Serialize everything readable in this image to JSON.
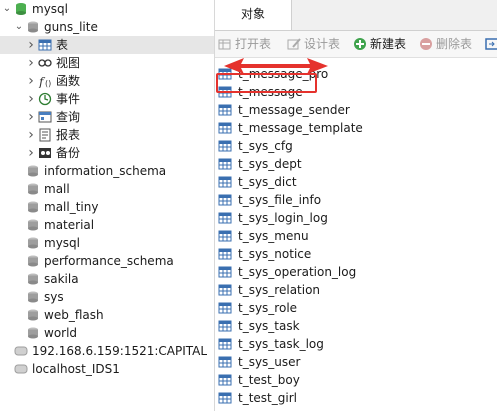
{
  "tree": {
    "items": [
      {
        "label": "mysql",
        "kind": "conn",
        "level": 0,
        "expand": "open",
        "selected": false
      },
      {
        "label": "guns_lite",
        "kind": "db",
        "level": 1,
        "expand": "open",
        "selected": false
      },
      {
        "label": "表",
        "kind": "table",
        "level": 2,
        "expand": "closed",
        "selected": true
      },
      {
        "label": "视图",
        "kind": "view",
        "level": 2,
        "expand": "closed",
        "selected": false
      },
      {
        "label": "函数",
        "kind": "func",
        "level": 2,
        "expand": "closed",
        "selected": false
      },
      {
        "label": "事件",
        "kind": "event",
        "level": 2,
        "expand": "closed",
        "selected": false
      },
      {
        "label": "查询",
        "kind": "query",
        "level": 2,
        "expand": "closed",
        "selected": false
      },
      {
        "label": "报表",
        "kind": "report",
        "level": 2,
        "expand": "closed",
        "selected": false
      },
      {
        "label": "备份",
        "kind": "backup",
        "level": 2,
        "expand": "closed",
        "selected": false
      },
      {
        "label": "information_schema",
        "kind": "db",
        "level": 1,
        "expand": "none",
        "selected": false
      },
      {
        "label": "mall",
        "kind": "db",
        "level": 1,
        "expand": "none",
        "selected": false
      },
      {
        "label": "mall_tiny",
        "kind": "db",
        "level": 1,
        "expand": "none",
        "selected": false
      },
      {
        "label": "material",
        "kind": "db",
        "level": 1,
        "expand": "none",
        "selected": false
      },
      {
        "label": "mysql",
        "kind": "db",
        "level": 1,
        "expand": "none",
        "selected": false
      },
      {
        "label": "performance_schema",
        "kind": "db",
        "level": 1,
        "expand": "none",
        "selected": false
      },
      {
        "label": "sakila",
        "kind": "db",
        "level": 1,
        "expand": "none",
        "selected": false
      },
      {
        "label": "sys",
        "kind": "db",
        "level": 1,
        "expand": "none",
        "selected": false
      },
      {
        "label": "web_flash",
        "kind": "db",
        "level": 1,
        "expand": "none",
        "selected": false
      },
      {
        "label": "world",
        "kind": "db",
        "level": 1,
        "expand": "none",
        "selected": false
      },
      {
        "label": "192.168.6.159:1521:CAPITAL",
        "kind": "server",
        "level": 0,
        "expand": "none",
        "selected": false
      },
      {
        "label": "localhost_IDS1",
        "kind": "server",
        "level": 0,
        "expand": "none",
        "selected": false
      }
    ]
  },
  "tabs": {
    "objects": "对象"
  },
  "toolbar": {
    "open": "打开表",
    "design": "设计表",
    "new": "新建表",
    "delete": "删除表"
  },
  "tables": [
    "t_message_pro",
    "t_message",
    "t_message_sender",
    "t_message_template",
    "t_sys_cfg",
    "t_sys_dept",
    "t_sys_dict",
    "t_sys_file_info",
    "t_sys_login_log",
    "t_sys_menu",
    "t_sys_notice",
    "t_sys_operation_log",
    "t_sys_relation",
    "t_sys_role",
    "t_sys_task",
    "t_sys_task_log",
    "t_sys_user",
    "t_test_boy",
    "t_test_girl"
  ],
  "colors": {
    "annotation": "#e5322d",
    "selected_bg": "#e6e6e6",
    "db_icon": "#9e9e9e",
    "conn_icon": "#4caf50"
  }
}
